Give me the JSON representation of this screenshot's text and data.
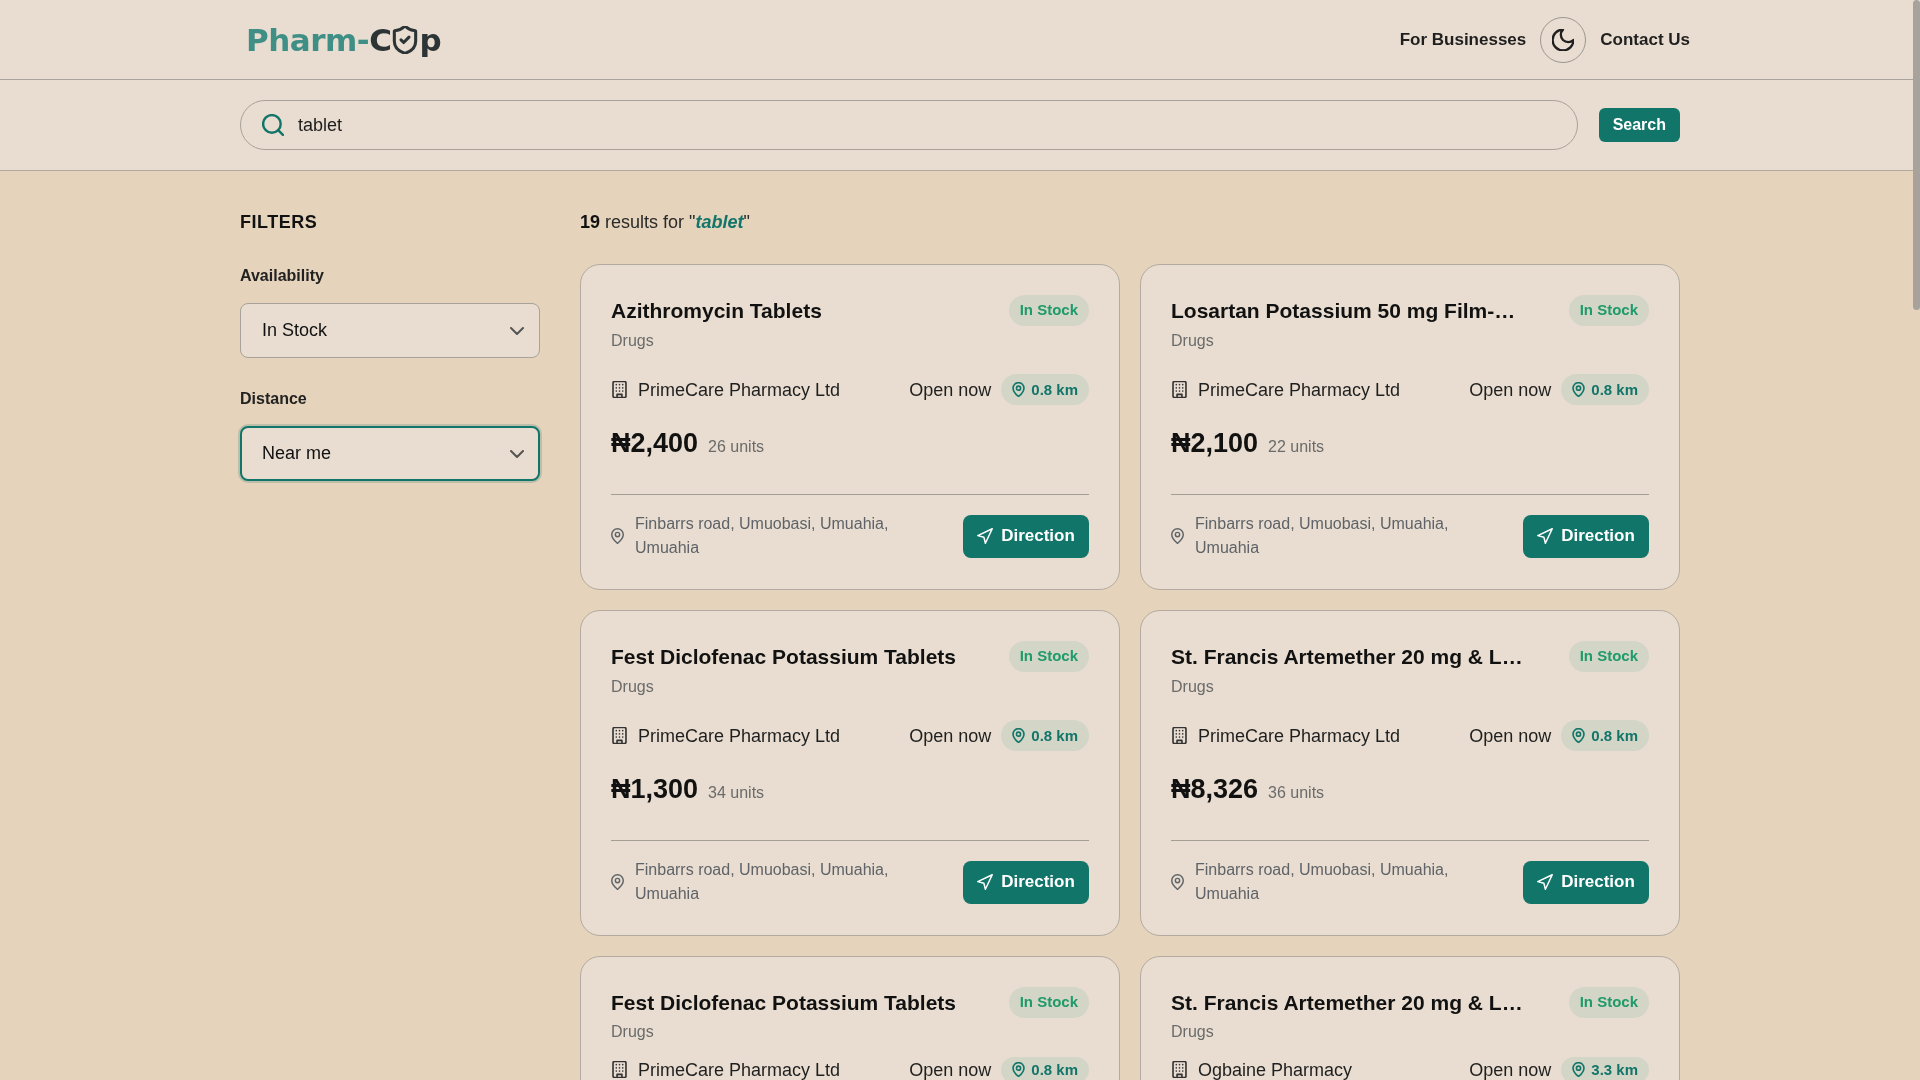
{
  "header": {
    "logo": {
      "teal_text": "Pharm-",
      "dark_text_before_icon": "C",
      "dark_text_after_icon": "p"
    },
    "nav": [
      {
        "kind": "link",
        "label": "For Businesses"
      },
      {
        "kind": "theme-toggle"
      },
      {
        "kind": "link",
        "label": "Contact Us"
      }
    ]
  },
  "search": {
    "value": "tablet",
    "button": "Search"
  },
  "filters": {
    "title": "FILTERS",
    "groups": [
      {
        "label": "Availability",
        "value": "In Stock",
        "focused": false
      },
      {
        "label": "Distance",
        "value": "Near me",
        "focused": true
      }
    ]
  },
  "results": {
    "summary": "**19** results for \"*tablet*\"",
    "cards": [
      {
        "name": "Azithromycin Tablets",
        "stock": "In Stock",
        "category": "Drugs",
        "pharmacy": "PrimeCare Pharmacy Ltd",
        "hours": "Open now",
        "distance": "0.8 km",
        "price": "₦2,400",
        "units": "26 units",
        "address": "Finbarrs road, Umuobasi, Umuahia, Umuahia",
        "button": "Direction"
      },
      {
        "name": "Losartan Potassium 50 mg Film-…",
        "stock": "In Stock",
        "category": "Drugs",
        "pharmacy": "PrimeCare Pharmacy Ltd",
        "hours": "Open now",
        "distance": "0.8 km",
        "price": "₦2,100",
        "units": "22 units",
        "address": "Finbarrs road, Umuobasi, Umuahia, Umuahia",
        "button": "Direction"
      },
      {
        "name": "Fest Diclofenac Potassium Tablets",
        "stock": "In Stock",
        "category": "Drugs",
        "pharmacy": "PrimeCare Pharmacy Ltd",
        "hours": "Open now",
        "distance": "0.8 km",
        "price": "₦1,300",
        "units": "34 units",
        "address": "Finbarrs road, Umuobasi, Umuahia, Umuahia",
        "button": "Direction"
      },
      {
        "name": "St. Francis Artemether 20 mg & L…",
        "stock": "In Stock",
        "category": "Drugs",
        "pharmacy": "PrimeCare Pharmacy Ltd",
        "hours": "Open now",
        "distance": "0.8 km",
        "price": "₦8,326",
        "units": "36 units",
        "address": "Finbarrs road, Umuobasi, Umuahia, Umuahia",
        "button": "Direction"
      },
      {
        "name": "Fest Diclofenac Potassium Tablets",
        "stock": "In Stock",
        "category": "Drugs",
        "pharmacy": "PrimeCare Pharmacy Ltd",
        "hours": "Open now",
        "distance": "0.8 km"
      },
      {
        "name": "St. Francis Artemether 20 mg & L…",
        "stock": "In Stock",
        "category": "Drugs",
        "pharmacy": "Ogbaine Pharmacy",
        "hours": "Open now",
        "distance": "3.3 km"
      }
    ]
  }
}
